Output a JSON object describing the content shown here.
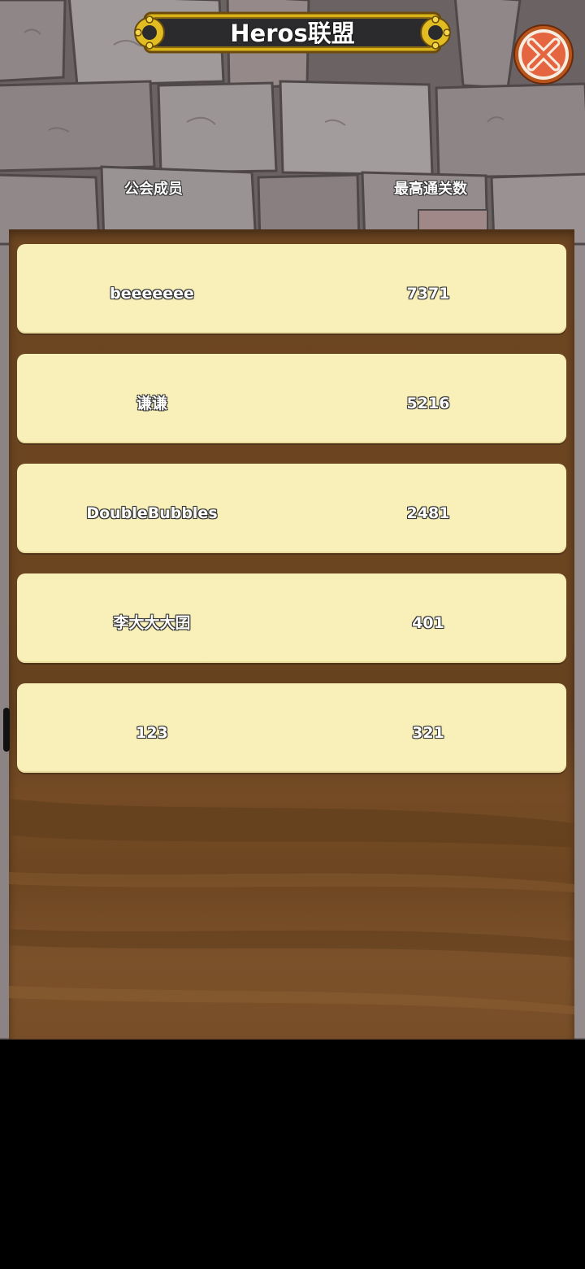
{
  "header": {
    "title": "Heros联盟",
    "close_icon": "close-x-icon"
  },
  "columns": {
    "member_label": "公会成员",
    "level_label": "最高通关数"
  },
  "members": [
    {
      "name": "beeeeeee",
      "score": "7371"
    },
    {
      "name": "谦谦",
      "score": "5216"
    },
    {
      "name": "DoubleBubbles",
      "score": "2481"
    },
    {
      "name": "李大大大囝",
      "score": "401"
    },
    {
      "name": "123",
      "score": "321"
    }
  ],
  "colors": {
    "row_background": "#f8f0b8",
    "panel_brown": "#6c4521",
    "banner_dark": "#2b2b2d",
    "banner_gold": "#d9b419",
    "close_red": "#e4653f"
  }
}
